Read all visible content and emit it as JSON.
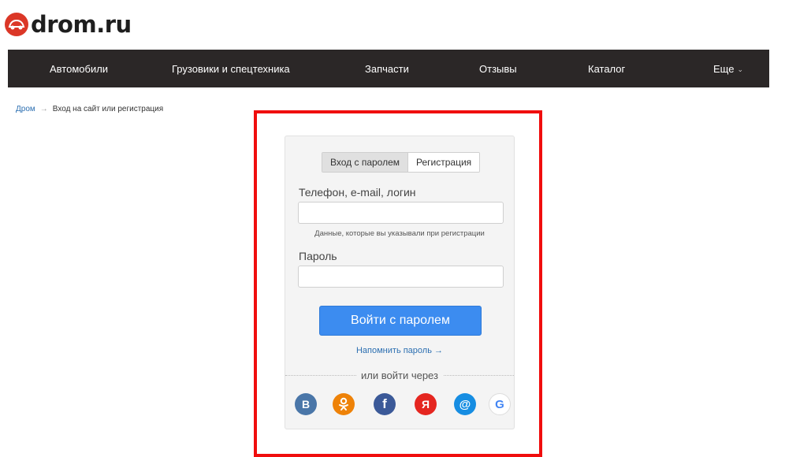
{
  "brand": {
    "logo_text": "drom.ru",
    "logo_color": "#db3727"
  },
  "nav": {
    "items": [
      {
        "label": "Автомобили"
      },
      {
        "label": "Грузовики и спецтехника"
      },
      {
        "label": "Запчасти"
      },
      {
        "label": "Отзывы"
      },
      {
        "label": "Каталог"
      }
    ],
    "more_label": "Еще",
    "background": "#2b2727"
  },
  "breadcrumb": {
    "home": "Дром",
    "current": "Вход на сайт или регистрация"
  },
  "highlight_color": "#f00d0d",
  "login": {
    "tabs": [
      {
        "label": "Вход с паролем",
        "active": true
      },
      {
        "label": "Регистрация",
        "active": false
      }
    ],
    "login_field": {
      "label": "Телефон, e-mail, логин",
      "value": "",
      "placeholder": ""
    },
    "login_hint": "Данные, которые вы указывали при регистрации",
    "password_field": {
      "label": "Пароль",
      "value": "",
      "placeholder": ""
    },
    "submit_label": "Войти с паролем",
    "remind_label": "Напомнить пароль →",
    "alt_login_label": "или войти через",
    "social": [
      {
        "name": "vk-icon",
        "glyph": "B",
        "color": "#4a76a8"
      },
      {
        "name": "odnoklassniki-icon",
        "glyph": "",
        "color": "#ee8208"
      },
      {
        "name": "facebook-icon",
        "glyph": "f",
        "color": "#3b5998"
      },
      {
        "name": "yandex-icon",
        "glyph": "Я",
        "color": "#e52620"
      },
      {
        "name": "mailru-icon",
        "glyph": "@",
        "color": "#168de2"
      },
      {
        "name": "google-icon",
        "glyph": "G",
        "color": "#ffffff"
      }
    ],
    "accent": "#3c8cf0"
  }
}
